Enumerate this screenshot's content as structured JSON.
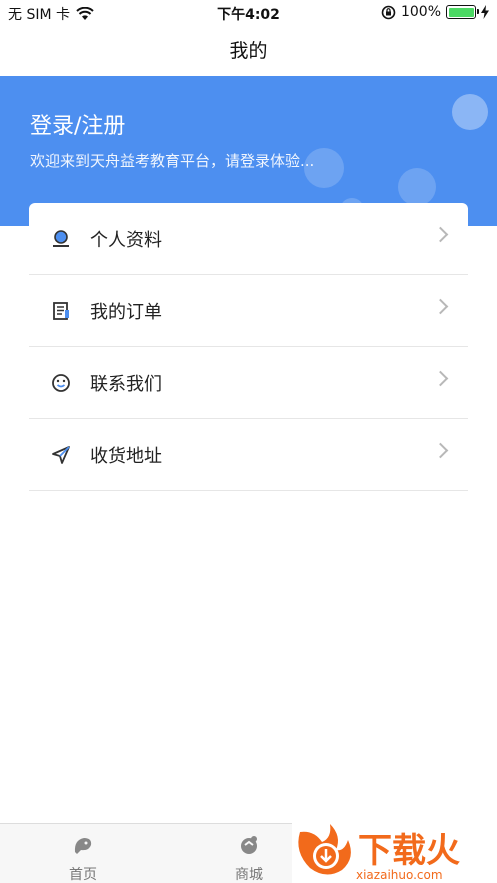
{
  "status_bar": {
    "carrier": "无 SIM 卡",
    "time": "下午4:02",
    "battery": "100%",
    "wifi_icon": "wifi-icon",
    "lock_icon": "rotation-lock-icon"
  },
  "nav": {
    "title": "我的"
  },
  "header": {
    "login_title": "登录/注册",
    "login_subtitle": "欢迎来到天舟益考教育平台，请登录体验...",
    "background_color": "#4d8ff0"
  },
  "menu": [
    {
      "label": "个人资料",
      "icon": "profile-icon"
    },
    {
      "label": "我的订单",
      "icon": "order-icon"
    },
    {
      "label": "联系我们",
      "icon": "smiley-icon"
    },
    {
      "label": "收货地址",
      "icon": "send-icon"
    }
  ],
  "tabs": [
    {
      "label": "首页",
      "icon": "home-bird-icon"
    },
    {
      "label": "商城",
      "icon": "mall-icon"
    }
  ],
  "watermark": {
    "brand": "下载火",
    "domain": "xiazaihuo.com"
  }
}
